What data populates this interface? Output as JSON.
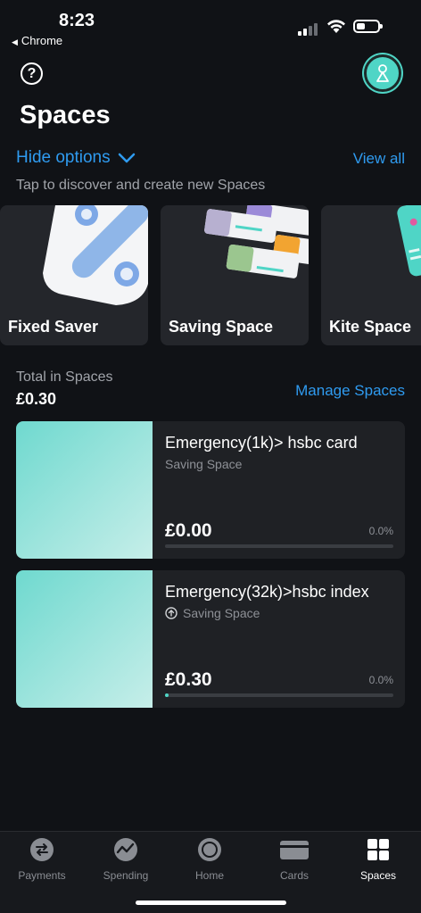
{
  "status_bar": {
    "time": "8:23",
    "back_app": "Chrome"
  },
  "header": {
    "help_glyph": "?",
    "title": "Spaces"
  },
  "options": {
    "hide_options": "Hide options",
    "view_all": "View all",
    "subtitle": "Tap to discover and create new Spaces"
  },
  "templates": [
    {
      "label": "Fixed Saver"
    },
    {
      "label": "Saving Space"
    },
    {
      "label": "Kite Space"
    }
  ],
  "total": {
    "label": "Total in Spaces",
    "value": "£0.30",
    "manage": "Manage Spaces"
  },
  "spaces": [
    {
      "name": "Emergency(1k)> hsbc card",
      "type": "Saving Space",
      "amount": "£0.00",
      "percent": "0.0%",
      "progress": 0.0
    },
    {
      "name": "Emergency(32k)>hsbc index",
      "type": "Saving Space",
      "amount": "£0.30",
      "percent": "0.0%",
      "progress": 0.01
    }
  ],
  "tabs": [
    {
      "label": "Payments",
      "icon": "payments-icon"
    },
    {
      "label": "Spending",
      "icon": "spending-icon"
    },
    {
      "label": "Home",
      "icon": "home-icon"
    },
    {
      "label": "Cards",
      "icon": "cards-icon"
    },
    {
      "label": "Spaces",
      "icon": "spaces-icon",
      "active": true
    }
  ],
  "colors": {
    "accent": "#2f9bf0",
    "teal": "#4fd5c6",
    "background": "#101216"
  }
}
